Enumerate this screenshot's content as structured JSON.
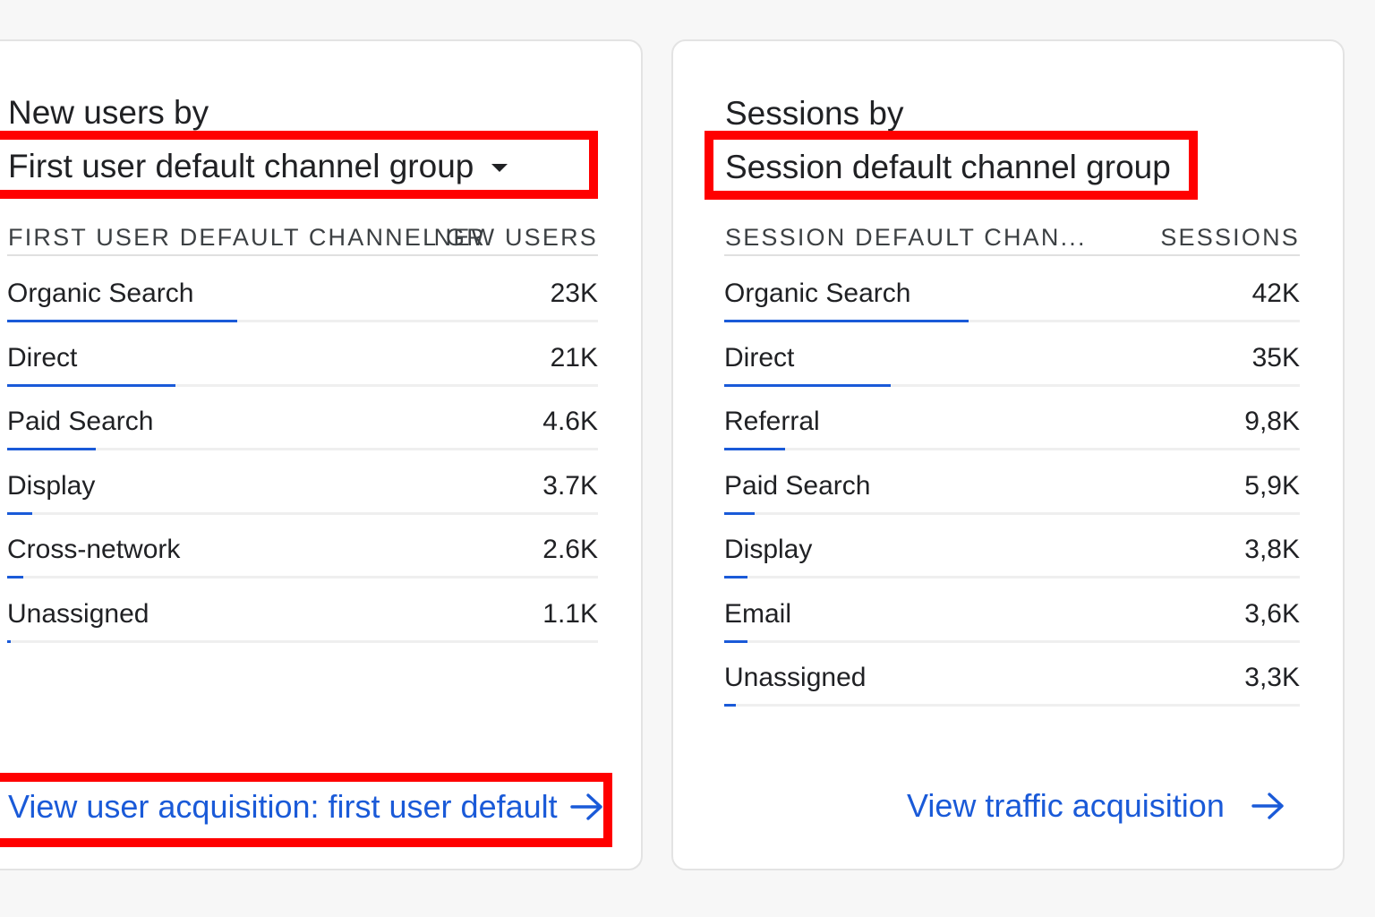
{
  "colors": {
    "accent": "#1a5ad8",
    "highlight": "#ff0000",
    "text": "#202124",
    "card_border": "#e3e3e3"
  },
  "left_card": {
    "title_line1": "New users by",
    "dimension_selector": "First user default channel group",
    "dropdown_icon": "caret-down-icon",
    "column_dimension": "FIRST USER DEFAULT CHANNEL GR",
    "column_metric": "NEW USERS",
    "rows": [
      {
        "label": "Organic Search",
        "value": "23K",
        "share": 0.39
      },
      {
        "label": "Direct",
        "value": "21K",
        "share": 0.285
      },
      {
        "label": "Paid Search",
        "value": "4.6K",
        "share": 0.15
      },
      {
        "label": "Display",
        "value": "3.7K",
        "share": 0.042
      },
      {
        "label": "Cross-network",
        "value": "2.6K",
        "share": 0.028
      },
      {
        "label": "Unassigned",
        "value": "1.1K",
        "share": 0.006
      }
    ],
    "view_link": "View user acquisition: first user default",
    "view_link_icon": "arrow-right-icon"
  },
  "right_card": {
    "title_line1": "Sessions  by",
    "dimension_selector": "Session default channel group",
    "column_dimension": "SESSION DEFAULT CHAN...",
    "column_metric": "SESSIONS",
    "rows": [
      {
        "label": "Organic Search",
        "value": "42K",
        "share": 0.425
      },
      {
        "label": "Direct",
        "value": "35K",
        "share": 0.29
      },
      {
        "label": "Referral",
        "value": "9,8K",
        "share": 0.105
      },
      {
        "label": "Paid Search",
        "value": "5,9K",
        "share": 0.053
      },
      {
        "label": "Display",
        "value": "3,8K",
        "share": 0.04
      },
      {
        "label": "Email",
        "value": "3,6K",
        "share": 0.04
      },
      {
        "label": "Unassigned",
        "value": "3,3K",
        "share": 0.02
      }
    ],
    "view_link": "View traffic acquisition",
    "view_link_icon": "arrow-right-icon"
  }
}
